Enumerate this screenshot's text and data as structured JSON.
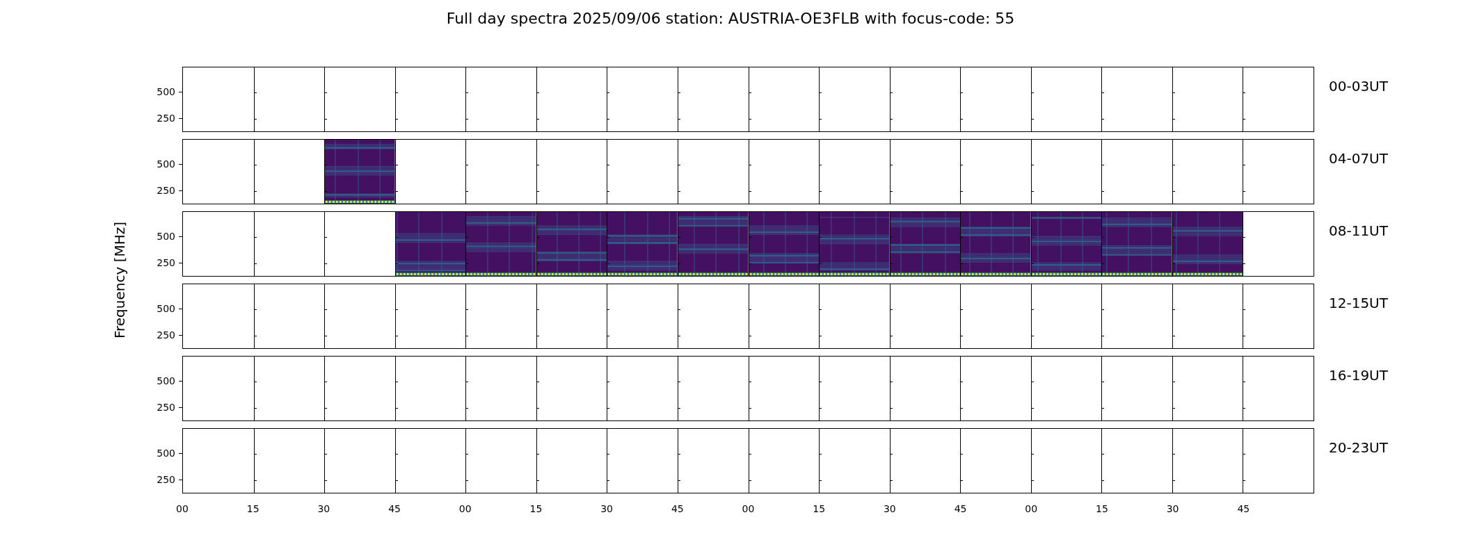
{
  "title": "Full day spectra 2025/09/06 station: AUSTRIA-OE3FLB with focus-code: 55",
  "ylabel": "Frequency [MHz]",
  "rows": [
    {
      "label": "00-03UT",
      "yticks": [
        "500",
        "250"
      ],
      "cells": [
        {
          "filled": false
        },
        {
          "filled": false
        },
        {
          "filled": false
        },
        {
          "filled": false
        },
        {
          "filled": false
        },
        {
          "filled": false
        },
        {
          "filled": false
        },
        {
          "filled": false
        },
        {
          "filled": false
        },
        {
          "filled": false
        },
        {
          "filled": false
        },
        {
          "filled": false
        },
        {
          "filled": false
        },
        {
          "filled": false
        },
        {
          "filled": false
        },
        {
          "filled": false
        }
      ]
    },
    {
      "label": "04-07UT",
      "yticks": [
        "500",
        "250"
      ],
      "cells": [
        {
          "filled": false
        },
        {
          "filled": false
        },
        {
          "filled": true
        },
        {
          "filled": false
        },
        {
          "filled": false
        },
        {
          "filled": false
        },
        {
          "filled": false
        },
        {
          "filled": false
        },
        {
          "filled": false
        },
        {
          "filled": false
        },
        {
          "filled": false
        },
        {
          "filled": false
        },
        {
          "filled": false
        },
        {
          "filled": false
        },
        {
          "filled": false
        },
        {
          "filled": false
        }
      ]
    },
    {
      "label": "08-11UT",
      "yticks": [
        "500",
        "250"
      ],
      "cells": [
        {
          "filled": false
        },
        {
          "filled": false
        },
        {
          "filled": false
        },
        {
          "filled": true
        },
        {
          "filled": true
        },
        {
          "filled": true
        },
        {
          "filled": true
        },
        {
          "filled": true
        },
        {
          "filled": true
        },
        {
          "filled": true
        },
        {
          "filled": true
        },
        {
          "filled": true
        },
        {
          "filled": true
        },
        {
          "filled": true
        },
        {
          "filled": true
        },
        {
          "filled": false
        }
      ]
    },
    {
      "label": "12-15UT",
      "yticks": [
        "500",
        "250"
      ],
      "cells": [
        {
          "filled": false
        },
        {
          "filled": false
        },
        {
          "filled": false
        },
        {
          "filled": false
        },
        {
          "filled": false
        },
        {
          "filled": false
        },
        {
          "filled": false
        },
        {
          "filled": false
        },
        {
          "filled": false
        },
        {
          "filled": false
        },
        {
          "filled": false
        },
        {
          "filled": false
        },
        {
          "filled": false
        },
        {
          "filled": false
        },
        {
          "filled": false
        },
        {
          "filled": false
        }
      ]
    },
    {
      "label": "16-19UT",
      "yticks": [
        "500",
        "250"
      ],
      "cells": [
        {
          "filled": false
        },
        {
          "filled": false
        },
        {
          "filled": false
        },
        {
          "filled": false
        },
        {
          "filled": false
        },
        {
          "filled": false
        },
        {
          "filled": false
        },
        {
          "filled": false
        },
        {
          "filled": false
        },
        {
          "filled": false
        },
        {
          "filled": false
        },
        {
          "filled": false
        },
        {
          "filled": false
        },
        {
          "filled": false
        },
        {
          "filled": false
        },
        {
          "filled": false
        }
      ]
    },
    {
      "label": "20-23UT",
      "yticks": [
        "500",
        "250"
      ],
      "cells": [
        {
          "filled": false
        },
        {
          "filled": false
        },
        {
          "filled": false
        },
        {
          "filled": false
        },
        {
          "filled": false
        },
        {
          "filled": false
        },
        {
          "filled": false
        },
        {
          "filled": false
        },
        {
          "filled": false
        },
        {
          "filled": false
        },
        {
          "filled": false
        },
        {
          "filled": false
        },
        {
          "filled": false
        },
        {
          "filled": false
        },
        {
          "filled": false
        },
        {
          "filled": false
        }
      ]
    }
  ],
  "xticks": [
    "00",
    "15",
    "30",
    "45",
    "00",
    "15",
    "30",
    "45",
    "00",
    "15",
    "30",
    "45",
    "00",
    "15",
    "30",
    "45"
  ]
}
